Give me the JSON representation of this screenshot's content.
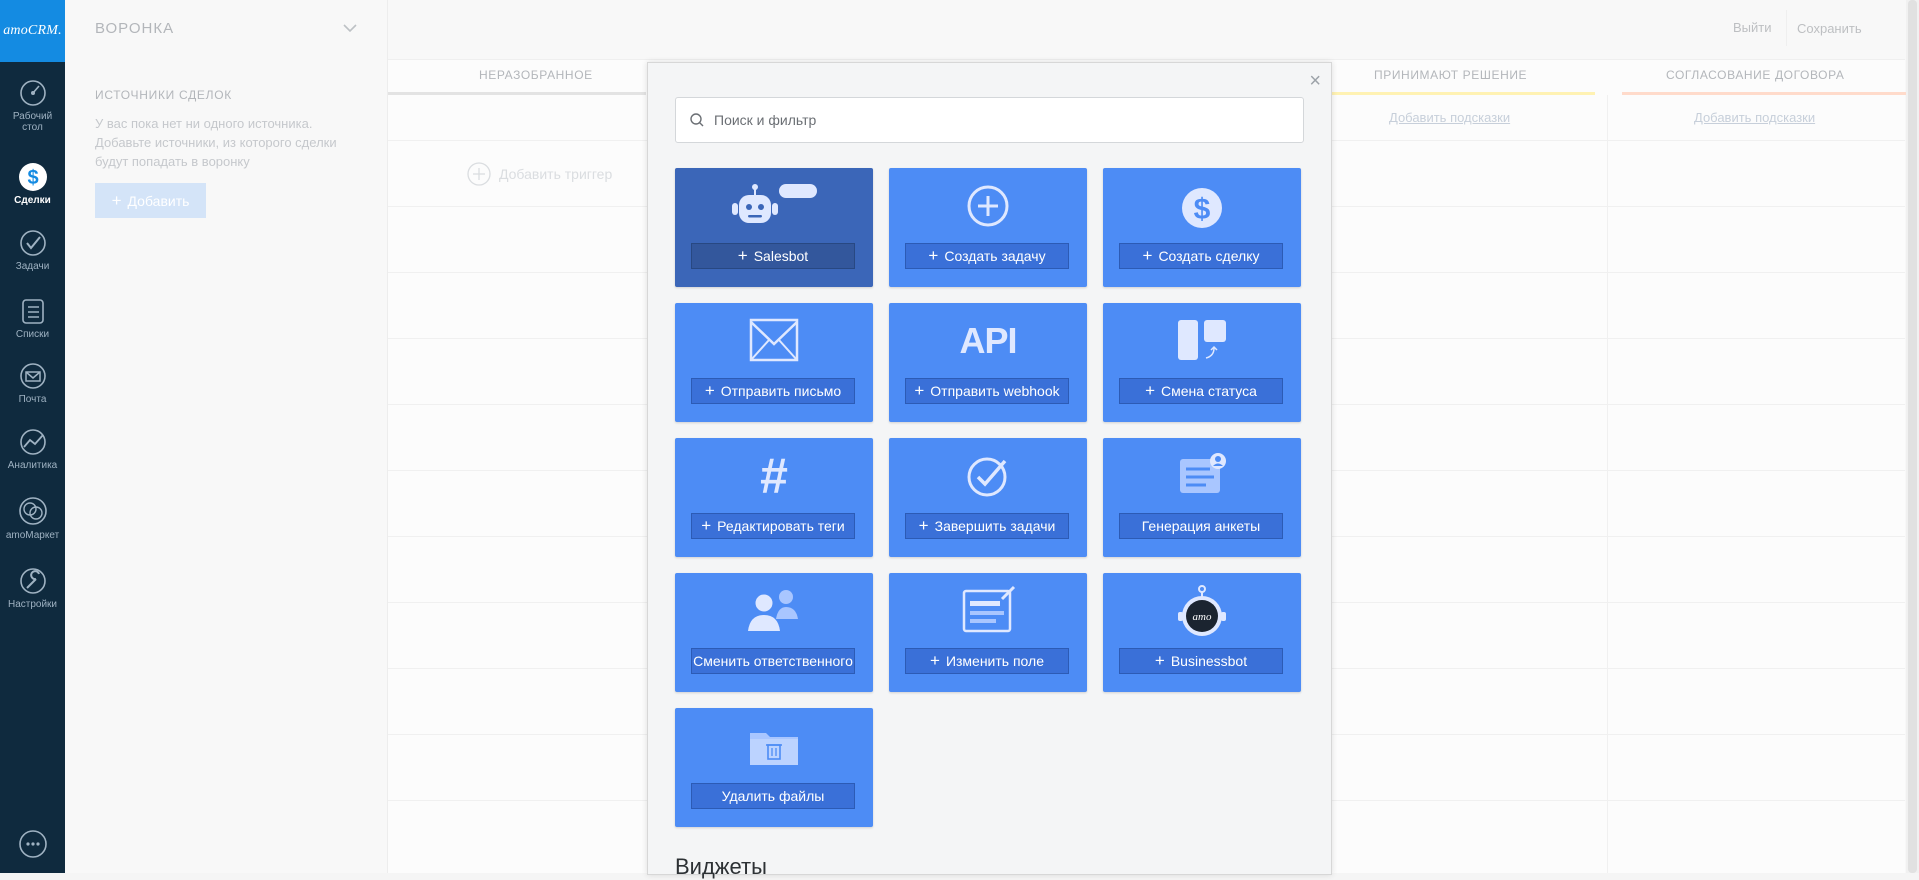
{
  "nav": {
    "logo": "amoCRM.",
    "items": [
      {
        "label": "Рабочий стол",
        "icon": "dashboard-icon"
      },
      {
        "label": "Сделки",
        "icon": "deals-icon"
      },
      {
        "label": "Задачи",
        "icon": "tasks-icon"
      },
      {
        "label": "Списки",
        "icon": "lists-icon"
      },
      {
        "label": "Почта",
        "icon": "mail-icon"
      },
      {
        "label": "Аналитика",
        "icon": "analytics-icon"
      },
      {
        "label": "amoМаркет",
        "icon": "market-icon"
      },
      {
        "label": "Настройки",
        "icon": "settings-icon"
      }
    ],
    "chat_icon": "chat-icon"
  },
  "header": {
    "pipeline_name": "ВОРОНКА",
    "exit_label": "Выйти",
    "save_label": "Сохранить"
  },
  "sources": {
    "title": "ИСТОЧНИКИ СДЕЛОК",
    "text": "У вас пока нет ни одного источника. Добавьте источники, из которого сделки будут попадать в воронку",
    "add_label": "Добавить"
  },
  "columns": [
    {
      "title": "НЕРАЗОБРАННОЕ",
      "color": "#c9c9c9"
    },
    {
      "title": "ПРИНИМАЮТ РЕШЕНИЕ",
      "color": "#ffeb8a",
      "hint": "Добавить подсказки"
    },
    {
      "title": "СОГЛАСОВАНИЕ ДОГОВОРА",
      "color": "#ffc8b0",
      "hint": "Добавить подсказки"
    }
  ],
  "add_trigger_label": "Добавить триггер",
  "modal": {
    "search_placeholder": "Поиск и фильтр",
    "tiles": [
      {
        "label": "Salesbot",
        "icon": "robot-icon",
        "plus": true
      },
      {
        "label": "Создать задачу",
        "icon": "plus-circle-icon",
        "plus": true
      },
      {
        "label": "Создать сделку",
        "icon": "dollar-icon",
        "plus": true
      },
      {
        "label": "Отправить письмо",
        "icon": "envelope-icon",
        "plus": true
      },
      {
        "label": "Отправить webhook",
        "icon": "api-icon",
        "icon_text": "API",
        "plus": true
      },
      {
        "label": "Смена статуса",
        "icon": "status-change-icon",
        "plus": true
      },
      {
        "label": "Редактировать теги",
        "icon": "hashtag-icon",
        "plus": true
      },
      {
        "label": "Завершить задачи",
        "icon": "check-circle-icon",
        "plus": true
      },
      {
        "label": "Генерация анкеты",
        "icon": "form-icon",
        "plus": false
      },
      {
        "label": "Сменить ответственного",
        "icon": "users-swap-icon",
        "plus": false
      },
      {
        "label": "Изменить поле",
        "icon": "edit-field-icon",
        "plus": true
      },
      {
        "label": "Businessbot",
        "icon": "amo-bot-icon",
        "icon_text": "amo",
        "plus": true
      },
      {
        "label": "Удалить файлы",
        "icon": "folder-delete-icon",
        "plus": false
      }
    ],
    "widgets_title": "Виджеты"
  },
  "colors": {
    "nav_bg": "#0f2a3e",
    "logo_bg": "#148be2",
    "tile": "#4d8cf5",
    "tile_active": "#3b66b8"
  }
}
